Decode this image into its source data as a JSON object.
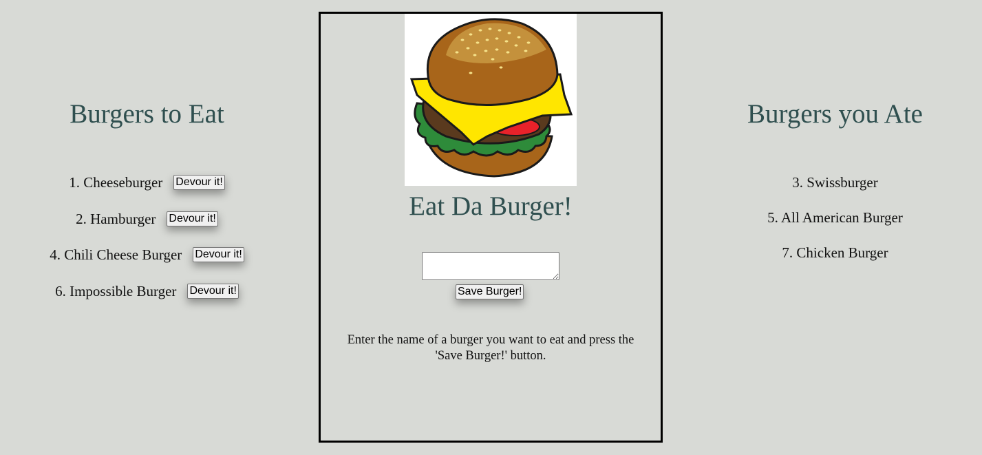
{
  "to_eat": {
    "heading": "Burgers to Eat",
    "items": [
      {
        "label": "1. Cheeseburger",
        "button": "Devour it!"
      },
      {
        "label": "2. Hamburger",
        "button": "Devour it!"
      },
      {
        "label": "4. Chili Cheese Burger",
        "button": "Devour it!"
      },
      {
        "label": "6. Impossible Burger",
        "button": "Devour it!"
      }
    ]
  },
  "center": {
    "title": "Eat Da Burger!",
    "input_value": "",
    "save_label": "Save Burger!",
    "instructions": "Enter the name of a burger you want to eat and press the 'Save Burger!' button."
  },
  "eaten": {
    "heading": "Burgers you Ate",
    "items": [
      "3. Swissburger",
      "5. All American Burger",
      "7. Chicken Burger"
    ]
  },
  "colors": {
    "background": "#d8dad6",
    "heading": "#2f4f4f",
    "bun": "#a8651a",
    "cheese": "#ffe600",
    "lettuce": "#2e8b3a",
    "patty": "#5a3a1e",
    "tomato": "#e8222a"
  },
  "icons": {
    "hero": "burger-illustration"
  }
}
